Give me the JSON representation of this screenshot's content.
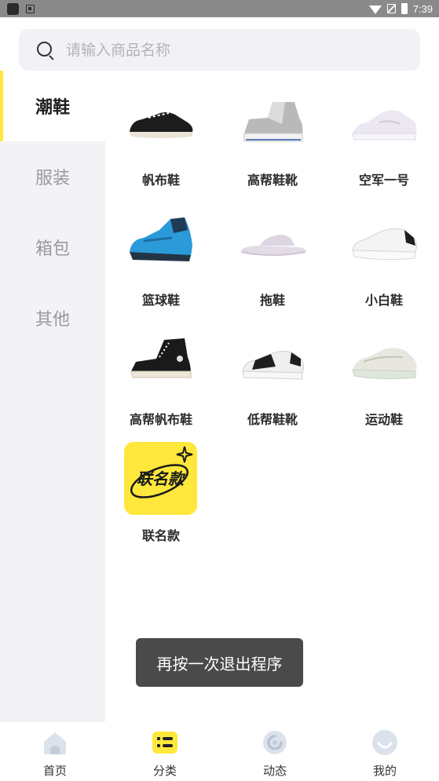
{
  "status_bar": {
    "time": "7:39"
  },
  "search": {
    "placeholder": "请输入商品名称"
  },
  "sidebar": {
    "items": [
      {
        "label": "潮鞋",
        "active": true
      },
      {
        "label": "服装",
        "active": false
      },
      {
        "label": "箱包",
        "active": false
      },
      {
        "label": "其他",
        "active": false
      }
    ]
  },
  "products": [
    {
      "label": "帆布鞋",
      "icon": "canvas-shoe-icon"
    },
    {
      "label": "高帮鞋靴",
      "icon": "high-top-sneaker-icon"
    },
    {
      "label": "空军一号",
      "icon": "air-force-one-icon"
    },
    {
      "label": "篮球鞋",
      "icon": "basketball-shoe-icon"
    },
    {
      "label": "拖鞋",
      "icon": "slipper-icon"
    },
    {
      "label": "小白鞋",
      "icon": "white-sneaker-icon"
    },
    {
      "label": "高帮帆布鞋",
      "icon": "high-top-canvas-icon"
    },
    {
      "label": "低帮鞋靴",
      "icon": "low-top-sneaker-icon"
    },
    {
      "label": "运动鞋",
      "icon": "running-shoe-icon"
    },
    {
      "label": "联名款",
      "icon": "collab-logo",
      "logo_text": "联名款"
    }
  ],
  "toast": {
    "text": "再按一次退出程序"
  },
  "bottom_nav": {
    "items": [
      {
        "label": "首页",
        "icon": "home-icon",
        "active": false
      },
      {
        "label": "分类",
        "icon": "category-icon",
        "active": true
      },
      {
        "label": "动态",
        "icon": "feed-icon",
        "active": false
      },
      {
        "label": "我的",
        "icon": "profile-icon",
        "active": false
      }
    ]
  },
  "colors": {
    "accent": "#ffe83b",
    "sidebar_bg": "#f3f3f6",
    "search_bg": "#f2f2f6",
    "toast_bg": "#4a4a4a"
  }
}
